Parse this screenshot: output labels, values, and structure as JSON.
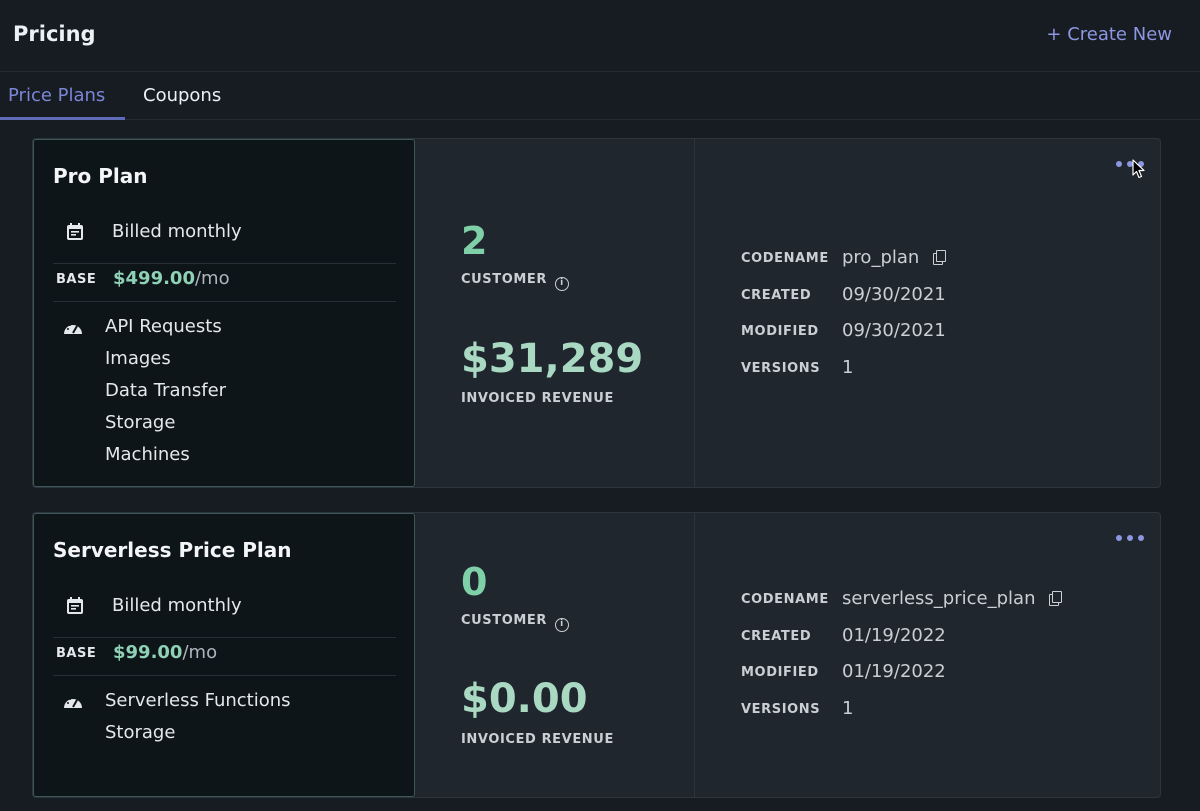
{
  "header": {
    "title": "Pricing",
    "create_new_label": "+ Create New"
  },
  "tabs": [
    {
      "label": "Price Plans",
      "active": true
    },
    {
      "label": "Coupons",
      "active": false
    }
  ],
  "plans": [
    {
      "name": "Pro Plan",
      "billing": "Billed monthly",
      "base_label": "BASE",
      "base_price": "$499.00",
      "base_unit": "/mo",
      "features": [
        "API Requests",
        "Images",
        "Data Transfer",
        "Storage",
        "Machines"
      ],
      "customer_count": "2",
      "customer_label": "CUSTOMER",
      "revenue": "$31,289",
      "revenue_label": "INVOICED REVENUE",
      "meta": {
        "codename_label": "CODENAME",
        "codename": "pro_plan",
        "created_label": "CREATED",
        "created": "09/30/2021",
        "modified_label": "MODIFIED",
        "modified": "09/30/2021",
        "versions_label": "VERSIONS",
        "versions": "1"
      }
    },
    {
      "name": "Serverless Price Plan",
      "billing": "Billed monthly",
      "base_label": "BASE",
      "base_price": "$99.00",
      "base_unit": "/mo",
      "features": [
        "Serverless Functions",
        "Storage"
      ],
      "customer_count": "0",
      "customer_label": "CUSTOMER",
      "revenue": "$0.00",
      "revenue_label": "INVOICED REVENUE",
      "meta": {
        "codename_label": "CODENAME",
        "codename": "serverless_price_plan",
        "created_label": "CREATED",
        "created": "01/19/2022",
        "modified_label": "MODIFIED",
        "modified": "01/19/2022",
        "versions_label": "VERSIONS",
        "versions": "1"
      }
    }
  ],
  "icons": {
    "calendar": "calendar-icon",
    "gauge": "speedometer-icon",
    "info": "info-icon",
    "copy": "copy-icon",
    "more": "more-horizontal-icon",
    "cursor": "mouse-pointer-icon"
  },
  "colors": {
    "accent": "#8d96e0",
    "positive": "#7fd0a8",
    "background": "#171c22",
    "card": "#1f262d"
  }
}
